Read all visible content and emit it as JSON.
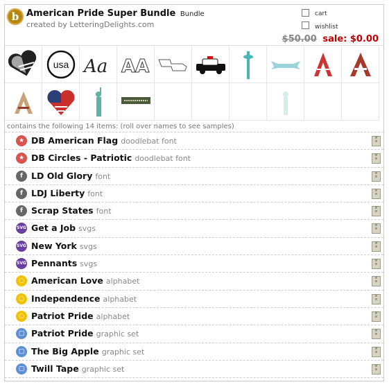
{
  "header": {
    "logo_letter": "b",
    "title": "American Pride Super Bundle",
    "kind": "Bundle",
    "creator": "created by LetteringDelights.com",
    "cart_label": "cart",
    "wishlist_label": "wishlist",
    "old_price": "$50.00",
    "sale_price": "sale: $0.00"
  },
  "thumbnails": [
    "heart-flag",
    "usa-circle",
    "script-aa",
    "outline-aa",
    "state-outline",
    "police-car",
    "space-needle",
    "ribbon-banner",
    "striped-a",
    "flag-a",
    "plain-a",
    "heart-flag-2",
    "statue-of-liberty",
    "air-force-tape",
    "",
    "statue-faded",
    "",
    "",
    "",
    ""
  ],
  "contains_text": "contains the following 14 items: (roll over names to see samples)",
  "items": [
    {
      "icon": "star",
      "name": "DB American Flag",
      "type": "doodlebat font",
      "color": "#d9534f"
    },
    {
      "icon": "star",
      "name": "DB Circles - Patriotic",
      "type": "doodlebat font",
      "color": "#d9534f"
    },
    {
      "icon": "f",
      "name": "LD Old Glory",
      "type": "font",
      "color": "#666666"
    },
    {
      "icon": "f",
      "name": "LDJ Liberty",
      "type": "font",
      "color": "#666666"
    },
    {
      "icon": "f",
      "name": "Scrap States",
      "type": "font",
      "color": "#666666"
    },
    {
      "icon": "SVG",
      "name": "Get a Job",
      "type": "svgs",
      "color": "#6a3fa0"
    },
    {
      "icon": "SVG",
      "name": "New York",
      "type": "svgs",
      "color": "#6a3fa0"
    },
    {
      "icon": "SVG",
      "name": "Pennants",
      "type": "svgs",
      "color": "#6a3fa0"
    },
    {
      "icon": "a",
      "name": "American Love",
      "type": "alphabet",
      "color": "#f2c200"
    },
    {
      "icon": "a",
      "name": "Independence",
      "type": "alphabet",
      "color": "#f2c200"
    },
    {
      "icon": "a",
      "name": "Patriot Pride",
      "type": "alphabet",
      "color": "#f2c200"
    },
    {
      "icon": "g",
      "name": "Patriot Pride",
      "type": "graphic set",
      "color": "#5b8fd9"
    },
    {
      "icon": "g",
      "name": "The Big Apple",
      "type": "graphic set",
      "color": "#5b8fd9"
    },
    {
      "icon": "g",
      "name": "Twill Tape",
      "type": "graphic set",
      "color": "#5b8fd9"
    }
  ]
}
